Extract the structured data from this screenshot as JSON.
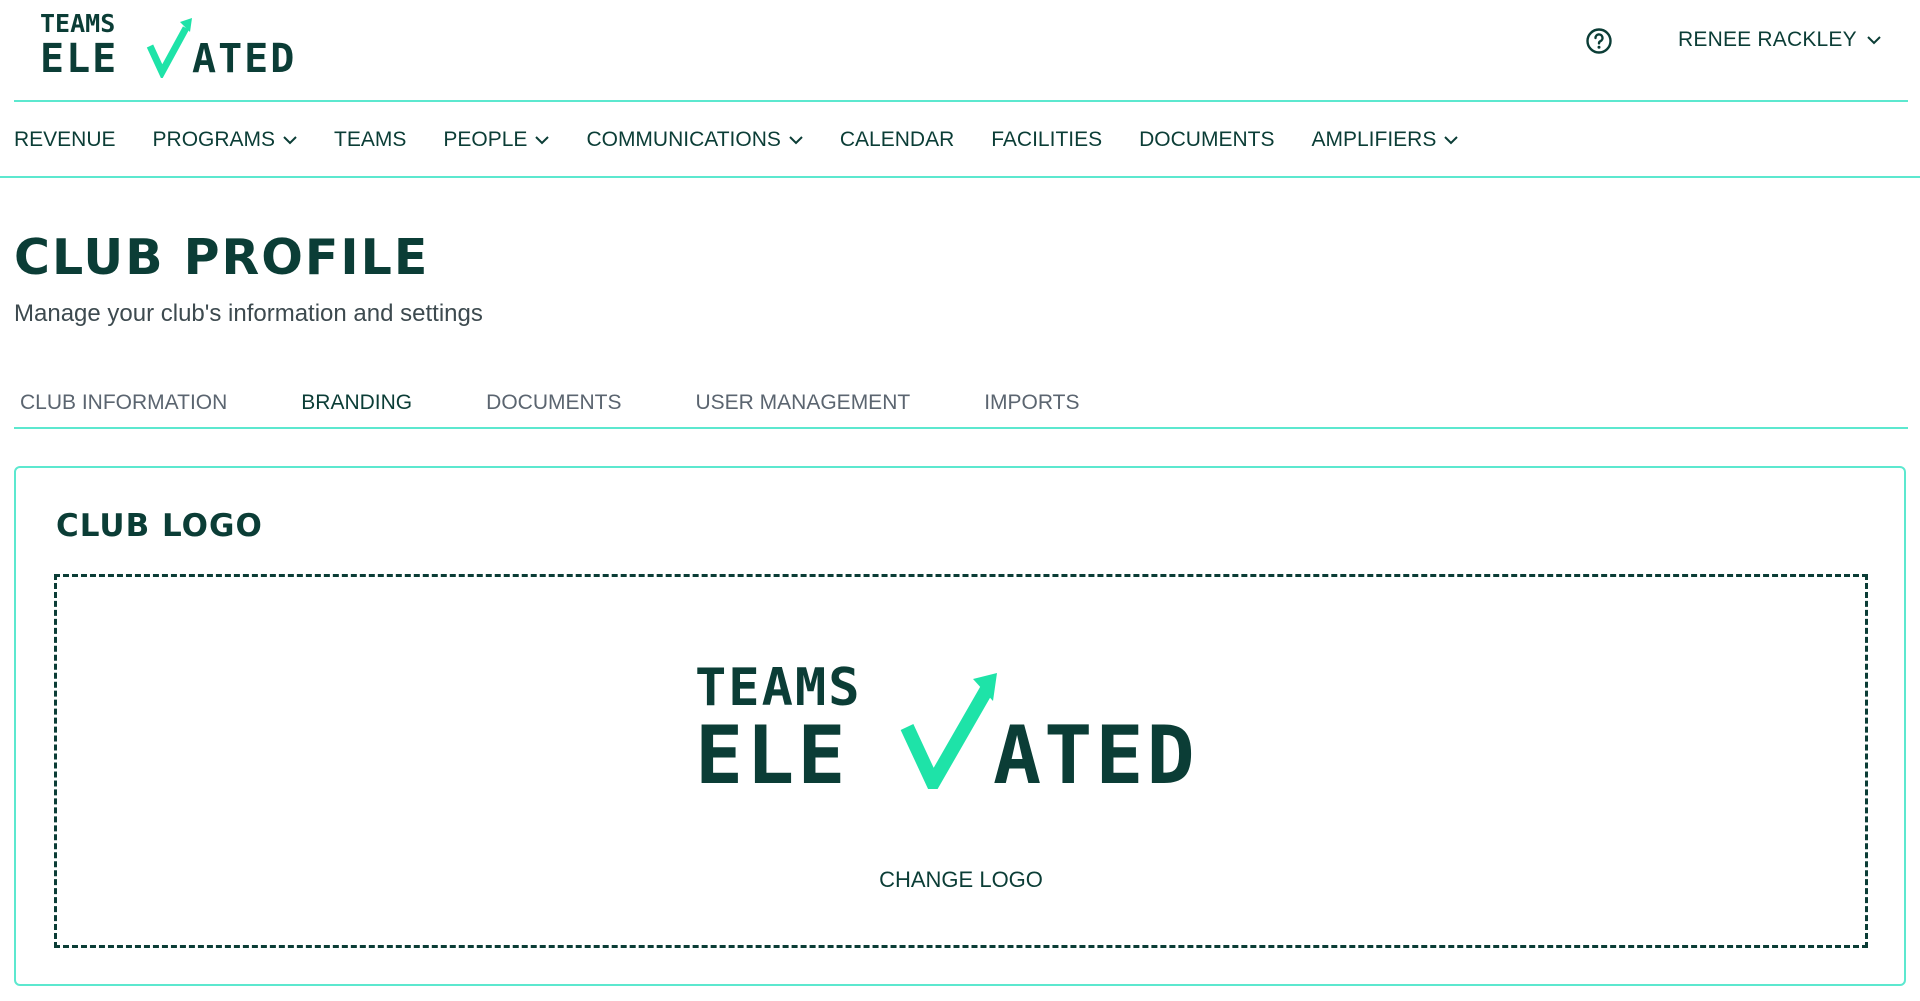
{
  "brand": {
    "line1": "TEAMS",
    "line2": "ELEVATED",
    "primary_color": "#0b3d36",
    "accent_color": "#1ee3a8"
  },
  "header": {
    "help_icon": "help-circle-icon",
    "user_name": "RENEE RACKLEY",
    "user_chevron_icon": "chevron-down-icon"
  },
  "nav": {
    "items": [
      {
        "label": "REVENUE",
        "has_dropdown": false
      },
      {
        "label": "PROGRAMS",
        "has_dropdown": true
      },
      {
        "label": "TEAMS",
        "has_dropdown": false
      },
      {
        "label": "PEOPLE",
        "has_dropdown": true
      },
      {
        "label": "COMMUNICATIONS",
        "has_dropdown": true
      },
      {
        "label": "CALENDAR",
        "has_dropdown": false
      },
      {
        "label": "FACILITIES",
        "has_dropdown": false
      },
      {
        "label": "DOCUMENTS",
        "has_dropdown": false
      },
      {
        "label": "AMPLIFIERS",
        "has_dropdown": true
      }
    ]
  },
  "page": {
    "title": "CLUB PROFILE",
    "subtitle": "Manage your club's information and settings"
  },
  "tabs": [
    {
      "label": "CLUB INFORMATION",
      "active": false
    },
    {
      "label": "BRANDING",
      "active": true
    },
    {
      "label": "DOCUMENTS",
      "active": false
    },
    {
      "label": "USER MANAGEMENT",
      "active": false
    },
    {
      "label": "IMPORTS",
      "active": false
    }
  ],
  "logo_card": {
    "title": "CLUB LOGO",
    "change_label": "CHANGE LOGO"
  },
  "colors": {
    "divider": "#5ce8cf",
    "text": "#0b3d36",
    "muted": "#5b6570"
  }
}
